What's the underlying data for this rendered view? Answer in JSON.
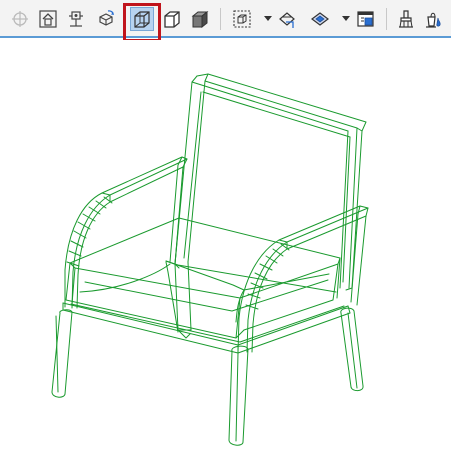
{
  "toolbar": {
    "buttons": [
      {
        "name": "plan-view-button",
        "icon": "plan-target-icon",
        "state": "disabled"
      },
      {
        "name": "home-view-button",
        "icon": "home-icon",
        "state": "normal"
      },
      {
        "name": "perspective-camera-button",
        "icon": "camera-person-icon",
        "state": "normal"
      },
      {
        "name": "explore-3d-button",
        "icon": "orbit-icon",
        "state": "normal"
      },
      {
        "name": "wireframe-button",
        "icon": "wireframe-box-icon",
        "state": "active"
      },
      {
        "name": "hidden-line-button",
        "icon": "hidden-line-box-icon",
        "state": "normal"
      },
      {
        "name": "shaded-button",
        "icon": "shaded-box-icon",
        "state": "normal"
      },
      {
        "name": "marquee-button",
        "icon": "marquee-box-icon",
        "state": "normal"
      },
      {
        "name": "cutting-planes-button",
        "icon": "cutting-plane-icon",
        "state": "normal"
      },
      {
        "name": "surface-painter-button",
        "icon": "surface-paint-icon",
        "state": "normal"
      },
      {
        "name": "export-view-button",
        "icon": "export-window-icon",
        "state": "normal"
      },
      {
        "name": "styles-button",
        "icon": "brush-icon",
        "state": "normal"
      },
      {
        "name": "materials-button",
        "icon": "paint-bucket-icon",
        "state": "normal"
      }
    ],
    "separator_color": "#c8c8c8",
    "accent_color": "#5b9bd5",
    "highlight_color": "#c0141c"
  },
  "viewport": {
    "object": "armchair",
    "render_mode": "wireframe",
    "line_color": "#1a9a2e"
  }
}
